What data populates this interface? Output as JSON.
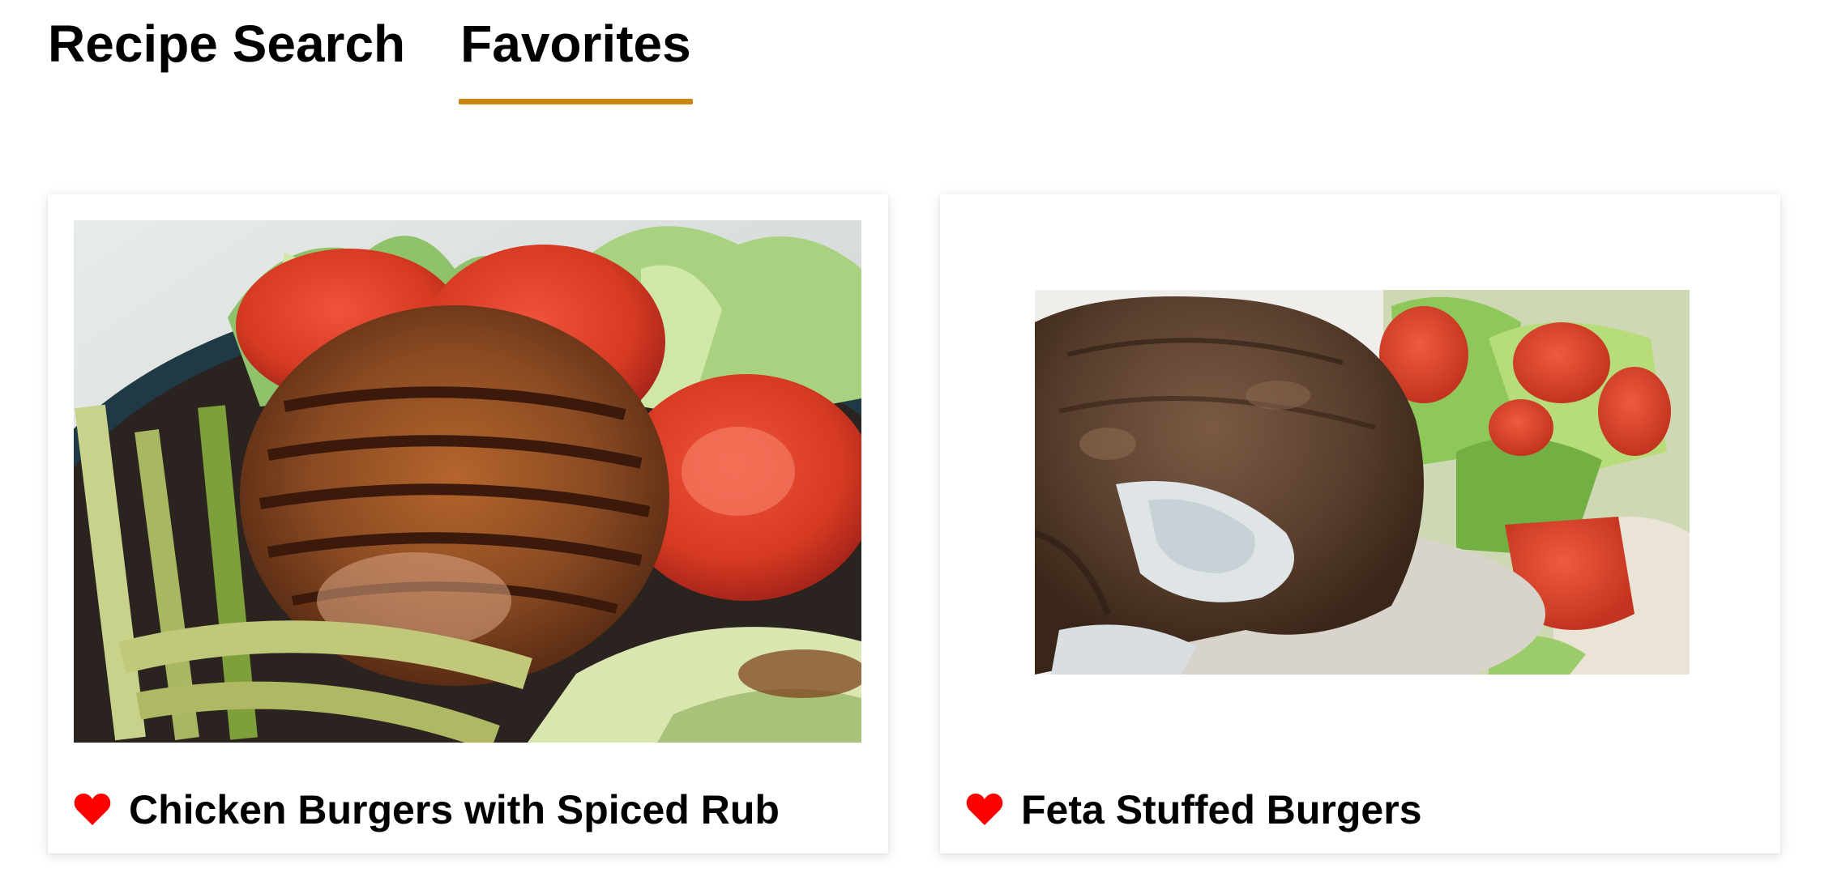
{
  "tabs": [
    {
      "label": "Recipe Search",
      "active": false
    },
    {
      "label": "Favorites",
      "active": true
    }
  ],
  "colors": {
    "accent": "#c98514",
    "heart": "#ff0000",
    "text": "#000000",
    "card_bg": "#ffffff"
  },
  "favorites": [
    {
      "title": "Chicken Burgers with Spiced Rub",
      "favorited": true,
      "heart_icon": "heart-icon",
      "photo": "grilled chicken burger with tomatoes, lettuce and spring onions"
    },
    {
      "title": "Feta Stuffed Burgers",
      "favorited": true,
      "heart_icon": "heart-icon",
      "photo": "feta stuffed beef burger with tomato salad"
    }
  ]
}
